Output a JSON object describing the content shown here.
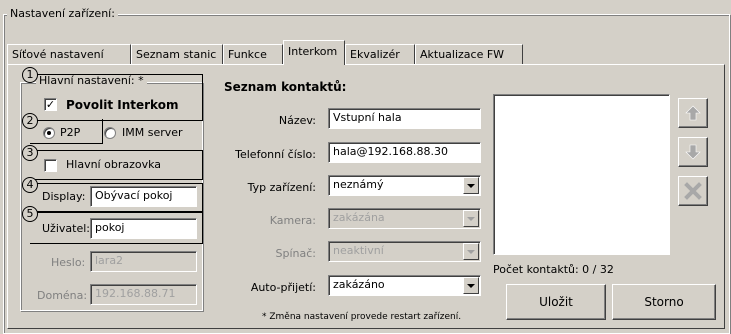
{
  "outer_group": {
    "title": "Nastavení zařízení:"
  },
  "tabs": [
    {
      "label": "Síťové nastavení"
    },
    {
      "label": "Seznam stanic"
    },
    {
      "label": "Funkce"
    },
    {
      "label": "Interkom",
      "active": true
    },
    {
      "label": "Ekvalizér"
    },
    {
      "label": "Aktualizace FW"
    }
  ],
  "main_settings": {
    "title": "Hlavní nastavení: *",
    "enable_label": "Povolit Interkom",
    "enable_checked": true,
    "mode_p2p": "P2P",
    "mode_imm": "IMM server",
    "mode_selected": "P2P",
    "main_screen_label": "Hlavní obrazovka",
    "main_screen_checked": false,
    "display_label": "Display:",
    "display_value": "Obývací pokoj",
    "user_label": "Uživatel:",
    "user_value": "pokoj",
    "password_label": "Heslo:",
    "password_value": "lara2",
    "domain_label": "Doména:",
    "domain_value": "192.168.88.71"
  },
  "markers": [
    "1",
    "2",
    "3",
    "4",
    "5"
  ],
  "contacts": {
    "title": "Seznam kontaktů:",
    "name_label": "Název:",
    "name_value": "Vstupní hala",
    "phone_label": "Telefonní číslo:",
    "phone_value": "hala@192.168.88.30",
    "device_type_label": "Typ zařízení:",
    "device_type_value": "neznámý",
    "camera_label": "Kamera:",
    "camera_value": "zakázána",
    "switch_label": "Spínač:",
    "switch_value": "neaktivní",
    "auto_answer_label": "Auto-přijetí:",
    "auto_answer_value": "zakázáno",
    "restart_note": "* Změna nastavení provede restart zařízení.",
    "count_label": "Počet kontaktů: 0 / 32",
    "save_label": "Uložit",
    "cancel_label": "Storno"
  },
  "icons": {
    "move_up": "arrow-up-icon",
    "move_down": "arrow-down-icon",
    "delete": "delete-x-icon"
  }
}
